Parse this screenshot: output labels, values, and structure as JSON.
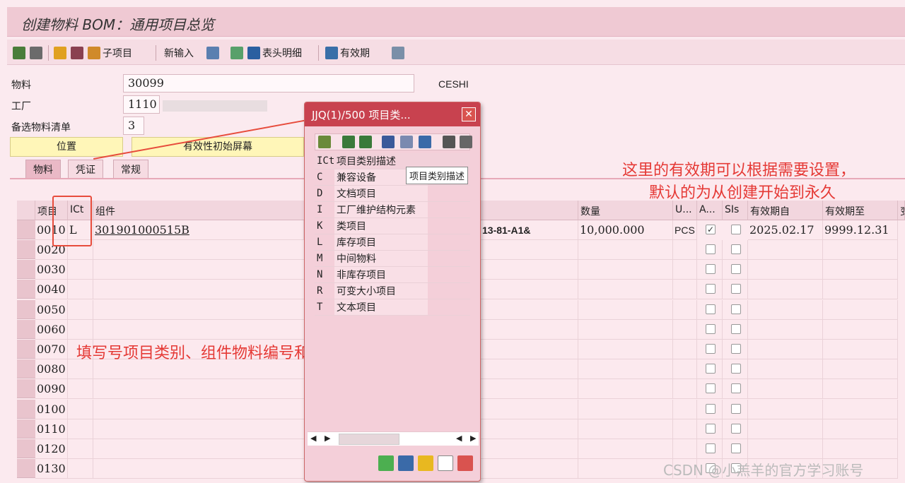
{
  "window": {
    "title": "创建物料 BOM：通用项目总览"
  },
  "toolbar": {
    "sub_item": "子项目",
    "new_entry": "新输入",
    "header_detail": "表头明细",
    "validity": "有效期"
  },
  "header": {
    "material_label": "物料",
    "material_value": "30099",
    "material_desc": "CESHI",
    "plant_label": "工厂",
    "plant_value": "1110",
    "altbom_label": "备选物料清单",
    "altbom_value": "3",
    "btn_position": "位置",
    "btn_validity_screen": "有效性初始屏幕"
  },
  "tabs": [
    "物料",
    "凭证",
    "常规"
  ],
  "grid": {
    "columns": [
      "项目",
      "ICt",
      "组件",
      "数量",
      "U...",
      "A...",
      "SIs",
      "有效期自",
      "有效期至",
      "变"
    ],
    "first_row": {
      "item": "0010",
      "ict": "L",
      "component": "301901000515B",
      "desc_partial": "13-81-A1&",
      "qty": "10,000.000",
      "unit": "PCS",
      "valid_from": "2025.02.17",
      "valid_to": "9999.12.31"
    },
    "items": [
      "0020",
      "0030",
      "0040",
      "0050",
      "0060",
      "0070",
      "0080",
      "0090",
      "0100",
      "0110",
      "0120",
      "0130"
    ]
  },
  "popup": {
    "title": "JJQ(1)/500 项目类...",
    "col_key": "ICt",
    "col_desc": "项目类别描述",
    "rows": [
      {
        "k": "C",
        "d": "兼容设备"
      },
      {
        "k": "D",
        "d": "文档项目"
      },
      {
        "k": "I",
        "d": "工厂维护结构元素"
      },
      {
        "k": "K",
        "d": "类项目"
      },
      {
        "k": "L",
        "d": "库存项目"
      },
      {
        "k": "M",
        "d": "中间物料"
      },
      {
        "k": "N",
        "d": "非库存项目"
      },
      {
        "k": "R",
        "d": "可变大小项目"
      },
      {
        "k": "T",
        "d": "文本项目"
      }
    ],
    "tooltip": "项目类别描述"
  },
  "annotations": {
    "right_line1": "这里的有效期可以根据需要设置，",
    "right_line2": "默认的为从创建开始到永久",
    "left": "填写号项目类别、组件物料编号和数量"
  },
  "watermark": "CSDN @小羔羊的官方学习账号"
}
